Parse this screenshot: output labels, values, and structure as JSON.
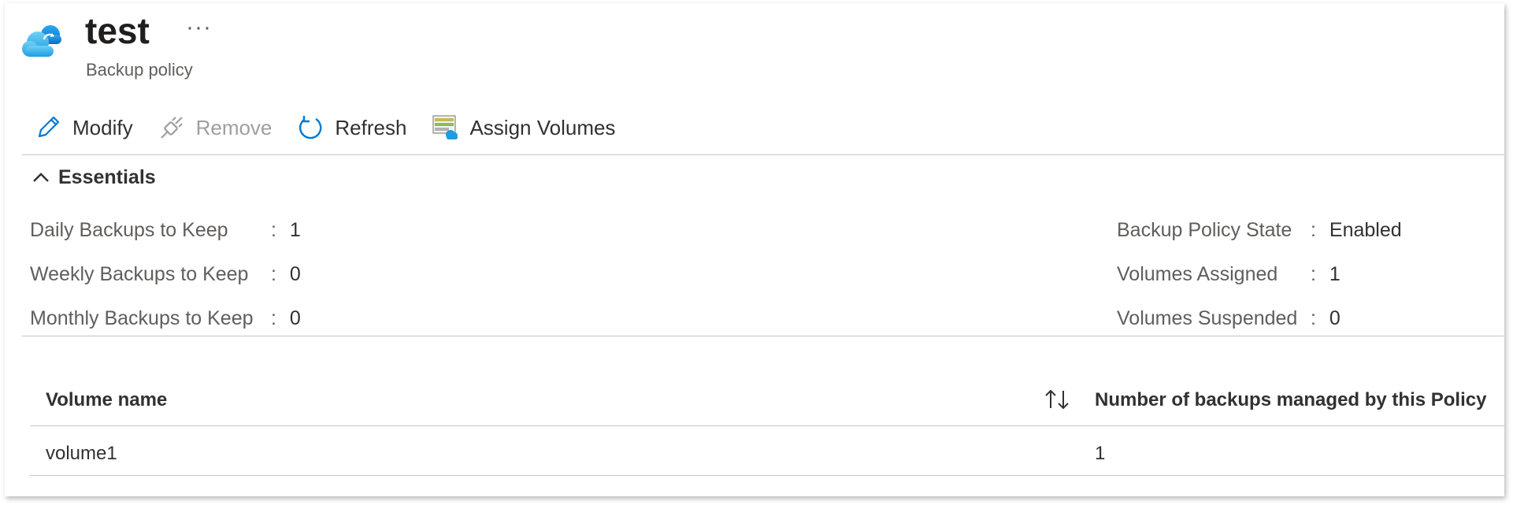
{
  "header": {
    "title": "test",
    "more": "···",
    "subtitle": "Backup policy",
    "logo_icon": "backup-cloud-icon"
  },
  "toolbar": {
    "modify": "Modify",
    "remove": "Remove",
    "refresh": "Refresh",
    "assign_volumes": "Assign Volumes"
  },
  "essentials": {
    "title": "Essentials",
    "left": [
      {
        "label": "Daily Backups to Keep",
        "sep": ":",
        "value": "1"
      },
      {
        "label": "Weekly Backups to Keep",
        "sep": ":",
        "value": "0"
      },
      {
        "label": "Monthly Backups to Keep",
        "sep": ":",
        "value": "0"
      }
    ],
    "right": [
      {
        "label": "Backup Policy State",
        "sep": ":",
        "value": "Enabled"
      },
      {
        "label": "Volumes Assigned",
        "sep": ":",
        "value": "1"
      },
      {
        "label": "Volumes Suspended",
        "sep": ":",
        "value": "0"
      }
    ]
  },
  "table": {
    "columns": [
      "Volume name",
      "Number of backups managed by this Policy"
    ],
    "rows": [
      [
        "volume1",
        "1"
      ]
    ]
  },
  "colors": {
    "accent": "#0078d4",
    "text": "#323130",
    "muted": "#605e5c",
    "disabled": "#a19f9d",
    "divider": "#c8c6c4"
  }
}
